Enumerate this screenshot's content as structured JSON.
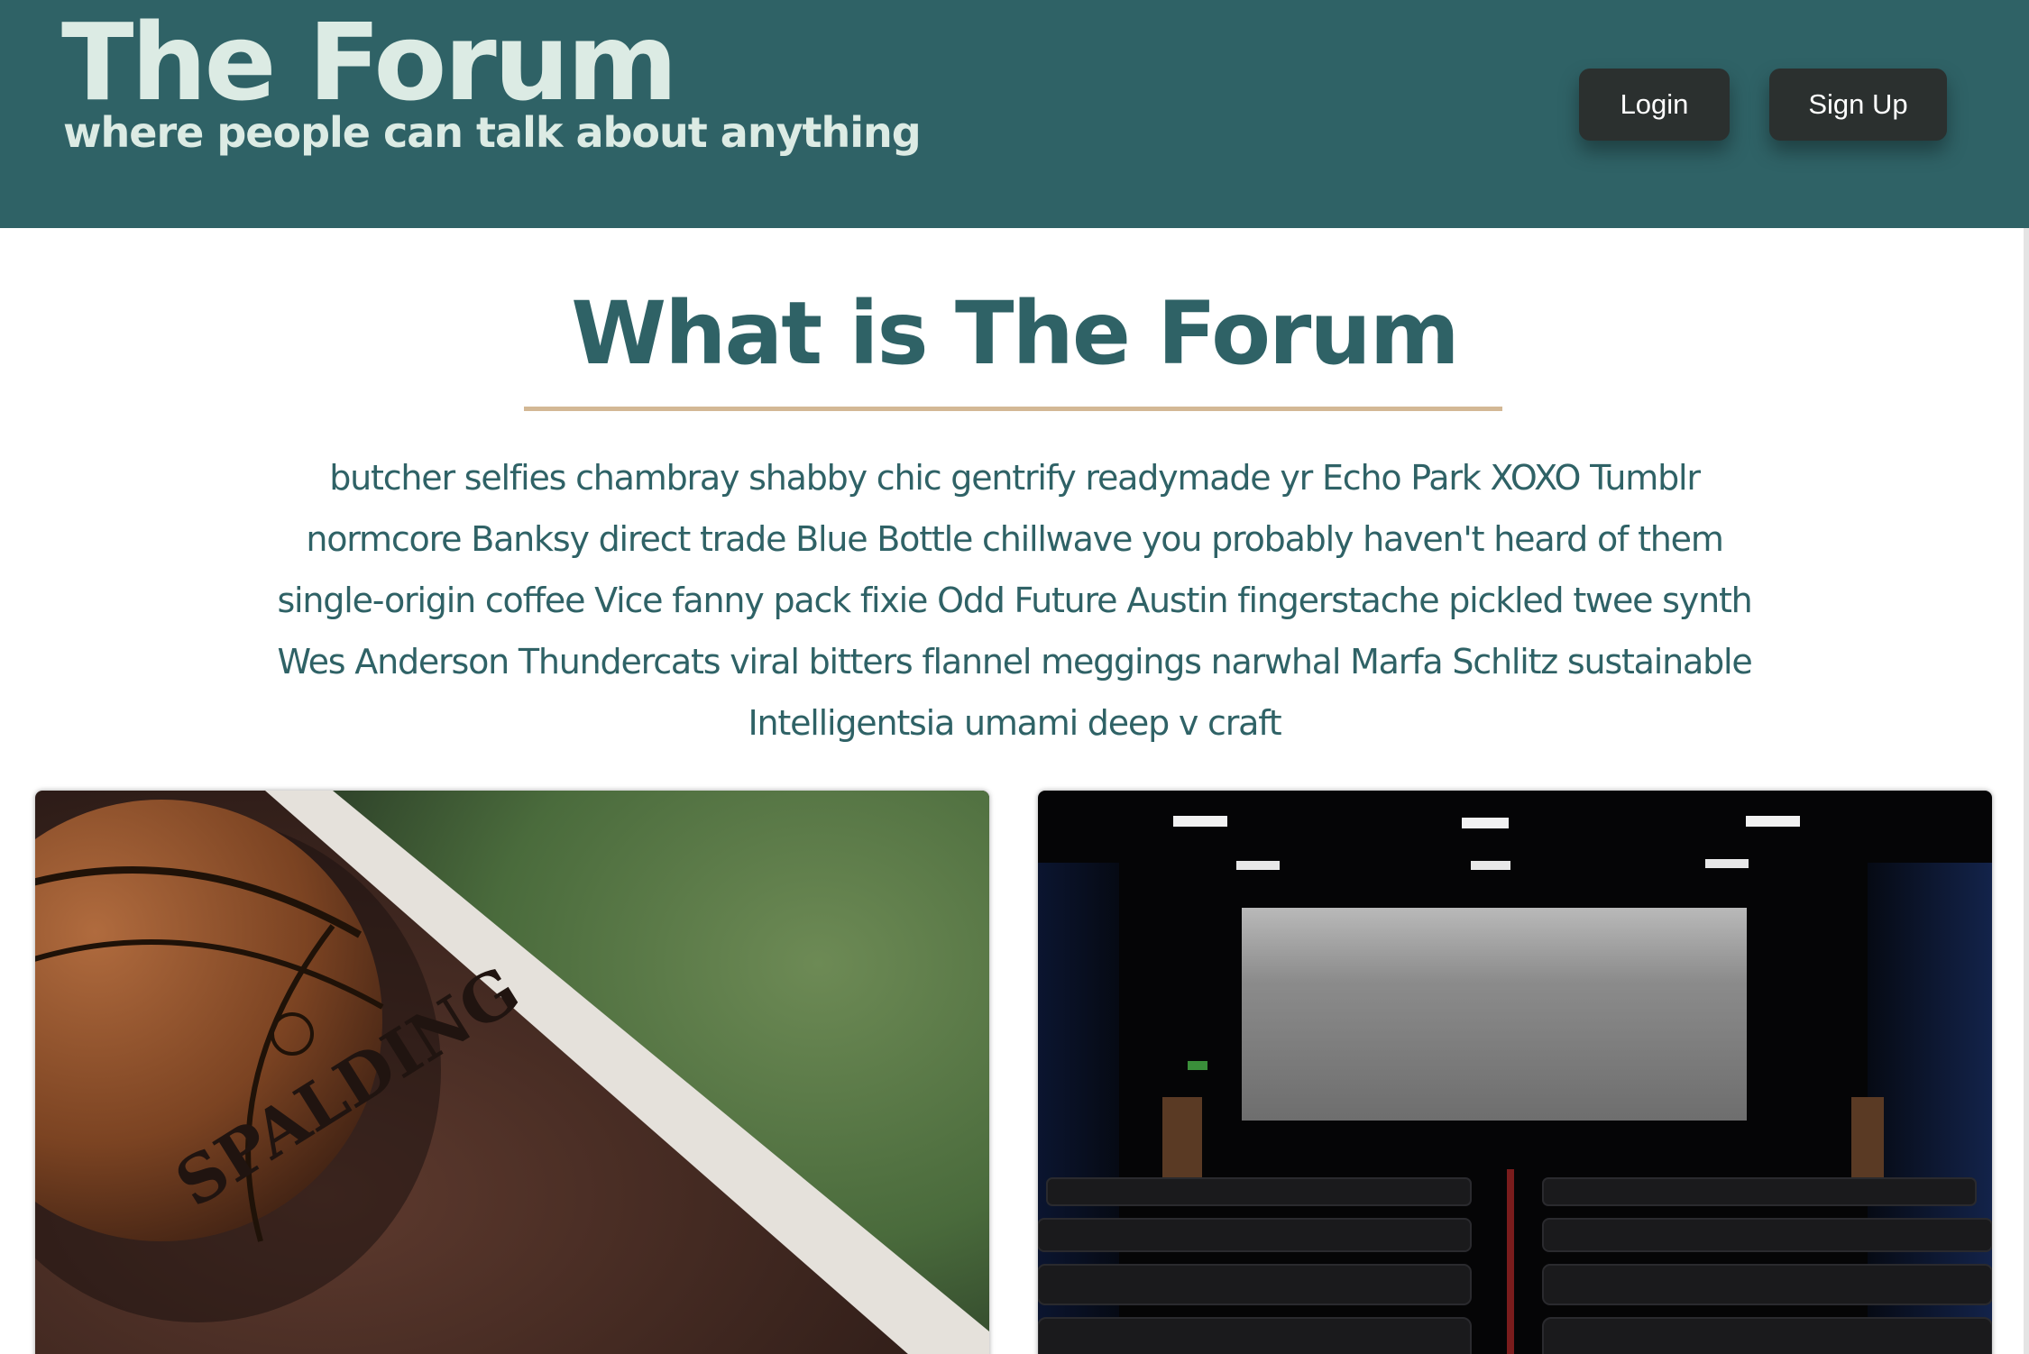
{
  "header": {
    "title": "The Forum",
    "tagline": "where people can talk about anything",
    "login_label": "Login",
    "signup_label": "Sign Up",
    "background_color": "#2f6266",
    "title_color": "#dcebe4",
    "button_color": "#2b302f"
  },
  "main": {
    "heading": "What is The Forum",
    "rule_color": "#d3b895",
    "intro": "butcher selfies chambray shabby chic gentrify readymade yr Echo Park XOXO Tumblr normcore Banksy direct trade Blue Bottle chillwave you probably haven't heard of them single-origin coffee Vice fanny pack fixie Odd Future Austin fingerstache pickled twee synth Wes Anderson Thundercats viral bitters flannel meggings narwhal Marfa Schlitz sustainable Intelligentsia umami deep v craft",
    "text_color": "#2f6266"
  },
  "cards": [
    {
      "image": "basketball-on-court-photo",
      "ball_text": "SPALDING"
    },
    {
      "image": "cinema-screen-photo"
    }
  ]
}
